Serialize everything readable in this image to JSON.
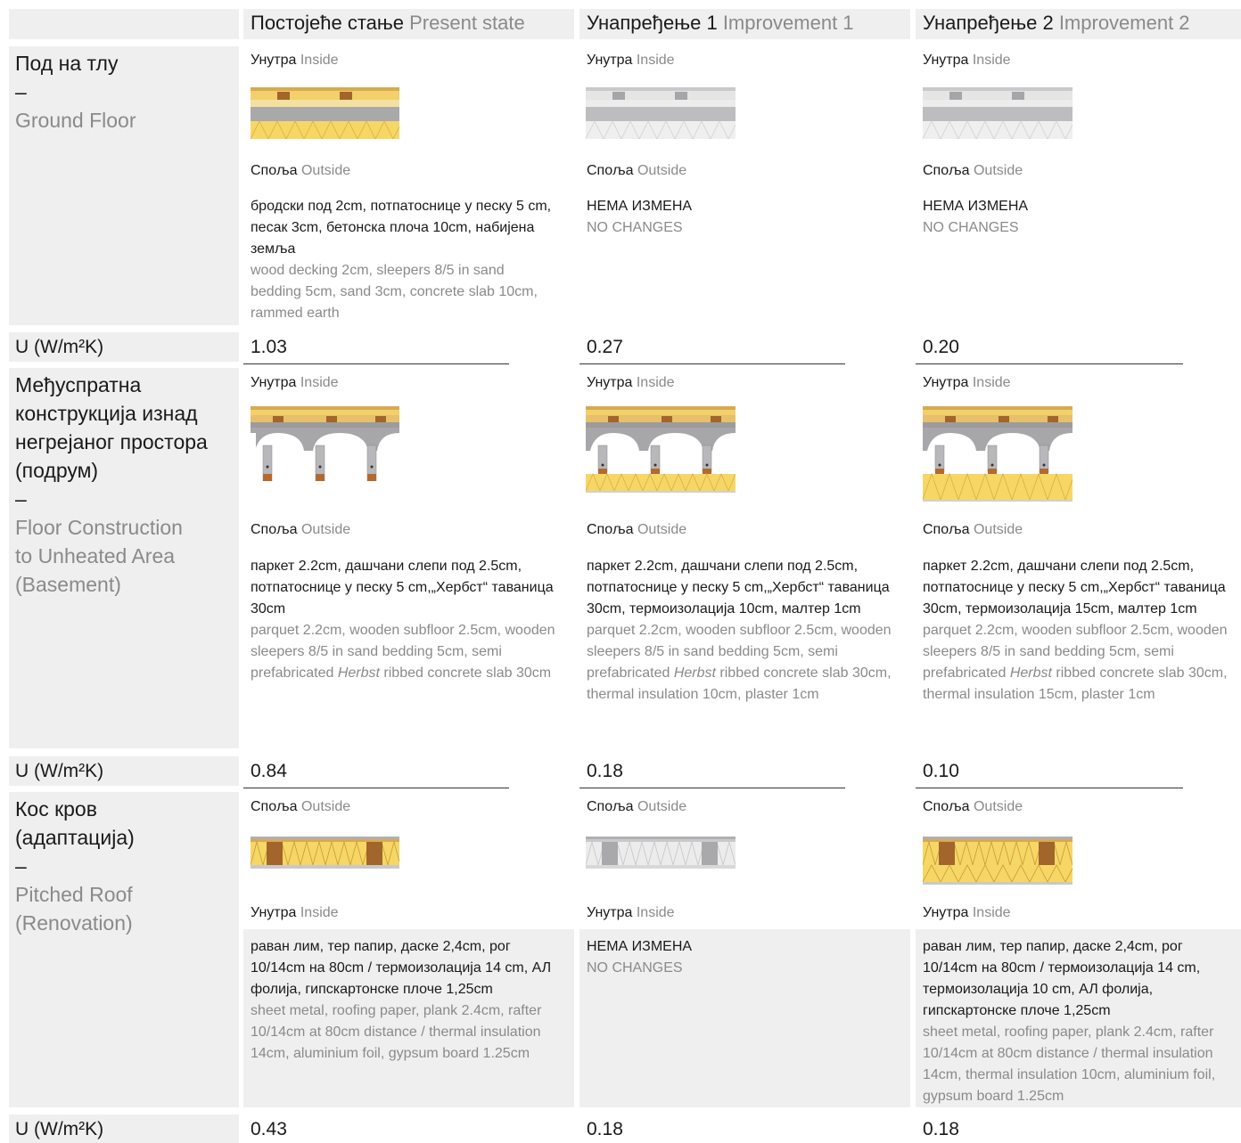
{
  "header": {
    "col1": {
      "sr": "Постојеће стање",
      "en": "Present state"
    },
    "col2": {
      "sr": "Унапређење 1",
      "en": "Improvement 1"
    },
    "col3": {
      "sr": "Унапређење 2",
      "en": "Improvement 2"
    }
  },
  "terms": {
    "inside_sr": "Унутра",
    "inside_en": "Inside",
    "outside_sr": "Споља",
    "outside_en": "Outside"
  },
  "u_label": "U (W/m²K)",
  "rows": [
    {
      "label_sr_lines": [
        "Под на тлу"
      ],
      "dash": "–",
      "label_en_lines": [
        "Ground Floor"
      ],
      "u_values": [
        "1.03",
        "0.27",
        "0.20"
      ],
      "cells": [
        {
          "sr": "бродски под 2cm, потпатоснице у песку 5 cm, песак 3cm, бетонска плоча 10cm, набијена земља",
          "en": "wood decking 2cm, sleepers 8/5 in sand bedding 5cm, sand 3cm, concrete slab 10cm, rammed earth"
        },
        {
          "sr": "НЕМА ИЗМЕНА",
          "en": "NO CHANGES"
        },
        {
          "sr": "НЕМА ИЗМЕНА",
          "en": "NO CHANGES"
        }
      ]
    },
    {
      "label_sr_lines": [
        "Међуспратна",
        "конструкција изнад",
        "негрејаног простора",
        "(подрум)"
      ],
      "dash": "–",
      "label_en_lines": [
        "Floor Construction",
        "to Unheated Area",
        "(Basement)"
      ],
      "u_values": [
        "0.84",
        "0.18",
        "0.10"
      ],
      "cells": [
        {
          "sr": "паркет 2.2cm, дашчани слепи под 2.5cm, потпатоснице у песку 5 cm,„Хербст“ таваница 30cm",
          "en_a": "parquet 2.2cm, wooden subfloor 2.5cm, wooden sleepers 8/5 in sand bedding 5cm, semi prefabricated ",
          "en_i": "Herbst",
          "en_b": " ribbed concrete slab 30cm"
        },
        {
          "sr": "паркет 2.2cm, дашчани слепи под 2.5cm, потпатоснице у песку 5 cm,„Хербст“ таваница 30cm, термоизолација 10cm, малтер 1cm",
          "en_a": "parquet 2.2cm, wooden subfloor 2.5cm, wooden sleepers 8/5 in sand bedding 5cm, semi prefabricated ",
          "en_i": "Herbst",
          "en_b": " ribbed concrete slab 30cm, thermal insulation 10cm, plaster 1cm"
        },
        {
          "sr": "паркет 2.2cm, дашчани слепи под 2.5cm, потпатоснице у песку 5 cm,„Хербст“ таваница 30cm, термоизолација 15cm, малтер 1cm",
          "en_a": "parquet 2.2cm, wooden subfloor 2.5cm, wooden sleepers 8/5 in sand bedding 5cm, semi prefabricated ",
          "en_i": "Herbst",
          "en_b": " ribbed concrete slab 30cm, thermal insulation 15cm, plaster 1cm"
        }
      ]
    },
    {
      "label_sr_lines": [
        "Кос кров",
        "(адаптација)"
      ],
      "dash": "–",
      "label_en_lines": [
        "Pitched Roof",
        "(Renovation)"
      ],
      "u_values": [
        "0.43",
        "0.18",
        "0.18"
      ],
      "cells": [
        {
          "sr": "раван лим, тер папир, даске 2,4cm, рог 10/14cm на 80cm / термоизолација 14 cm, АЛ фолија, гипскартонске плоче 1,25cm",
          "en": "sheet metal, roofing paper, plank 2.4cm, rafter 10/14cm at 80cm distance / thermal insulation 14cm, aluminium foil, gypsum board 1.25cm"
        },
        {
          "sr": "НЕМА ИЗМЕНА",
          "en": "NO CHANGES"
        },
        {
          "sr": "раван лим, тер папир, даске 2,4cm, рог 10/14cm на 80cm / термоизолација 14 cm, термоизолација 10 cm, АЛ фолија, гипскартонске плоче 1,25cm",
          "en": "sheet metal, roofing paper, plank 2.4cm, rafter 10/14cm at 80cm distance / thermal insulation 14cm, thermal insulation 10cm, aluminium foil, gypsum board 1.25cm"
        }
      ]
    }
  ]
}
